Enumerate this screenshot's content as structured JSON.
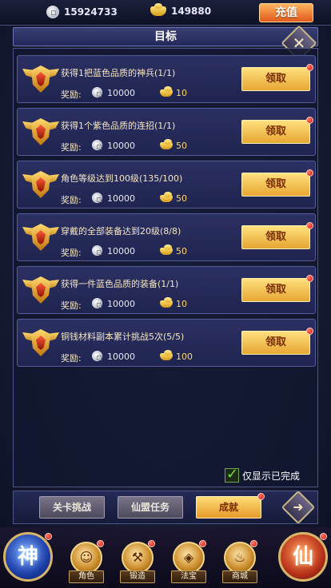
{
  "currency": {
    "silver_value": "15924733",
    "gold_value": "149880",
    "recharge_label": "充值"
  },
  "title": "目标",
  "reward_label": "奖励:",
  "claim_label": "领取",
  "tasks": [
    {
      "title": "获得1把蓝色品质的神兵(1/1)",
      "silver": "10000",
      "gold": "10"
    },
    {
      "title": "获得1个紫色品质的连招(1/1)",
      "silver": "10000",
      "gold": "50"
    },
    {
      "title": "角色等级达到100级(135/100)",
      "silver": "10000",
      "gold": "50"
    },
    {
      "title": "穿戴的全部装备达到20级(8/8)",
      "silver": "10000",
      "gold": "50"
    },
    {
      "title": "获得一件蓝色品质的装备(1/1)",
      "silver": "10000",
      "gold": "10"
    },
    {
      "title": "铜钱材料副本累计挑战5次(5/5)",
      "silver": "10000",
      "gold": "100"
    }
  ],
  "only_completed_label": "仅显示已完成",
  "tabs": [
    "关卡挑战",
    "仙盟任务",
    "成就"
  ],
  "nav": {
    "left_orb": "神",
    "right_orb": "仙",
    "items": [
      "角色",
      "锻造",
      "法宝",
      "商城"
    ]
  },
  "colors": {
    "claim_button": "#e7a632",
    "active_tab": "#e69a2a",
    "notification_dot": "#d21200"
  },
  "icons": {
    "silver_coin": "silver-coin-icon",
    "gold_ingot": "gold-ingot-icon",
    "close": "close-icon",
    "check": "check-icon"
  }
}
